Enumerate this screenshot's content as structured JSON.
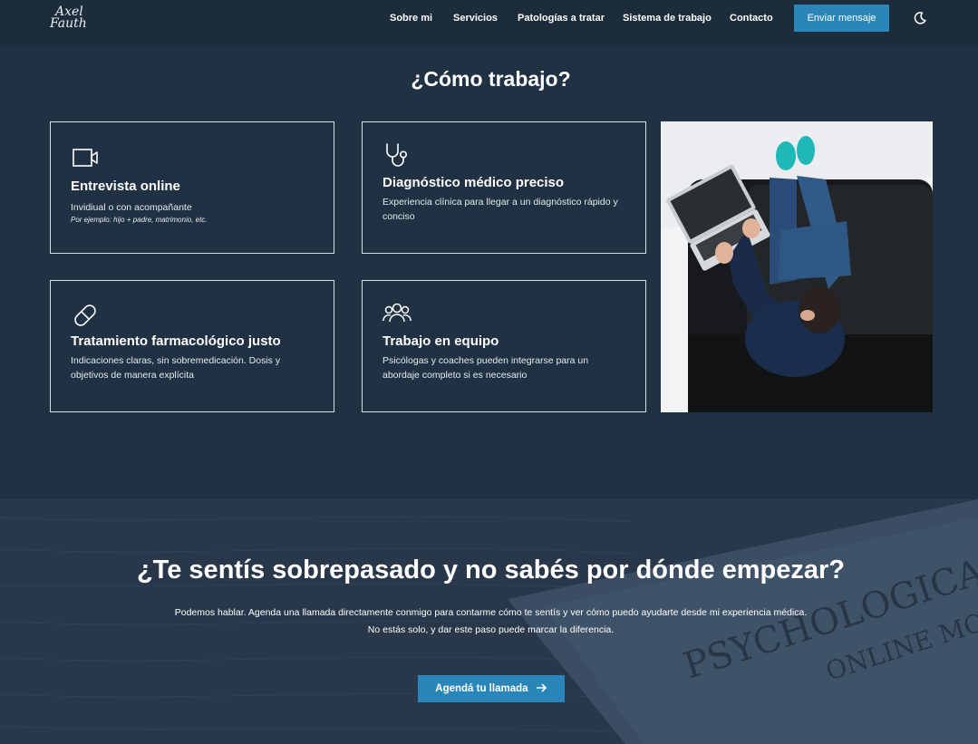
{
  "nav": {
    "logo": {
      "line1": "Axel",
      "line2": "Fauth"
    },
    "links": [
      "Sobre mi",
      "Servicios",
      "Patologías a tratar",
      "Sistema de trabajo",
      "Contacto"
    ],
    "cta": "Enviar mensaje",
    "theme_icon": "moon-icon"
  },
  "work": {
    "title": "¿Cómo trabajo?",
    "cards": [
      {
        "icon": "video-camera-icon",
        "title": "Entrevista online",
        "text": "Invidiual o con acompañante",
        "note": "Por ejemplo: hijo + padre, matrimonio, etc."
      },
      {
        "icon": "stethoscope-icon",
        "title": "Diagnóstico médico preciso",
        "text": "Experiencia clínica para llegar a un diagnóstico rápido y conciso"
      },
      {
        "icon": "pill-icon",
        "title": "Tratamiento farmacológico justo",
        "text": "Indicaciones claras, sin sobremedicación. Dosis y objetivos de manera explícita"
      },
      {
        "icon": "team-icon",
        "title": "Trabajo en equipo",
        "text": "Psicólogas y coaches pueden integrarse para un abordaje completo si es necesario"
      }
    ],
    "photo": "person-on-sofa-with-laptop"
  },
  "cta": {
    "title": "¿Te sentís sobrepasado y no sabés por dónde empezar?",
    "text1": "Podemos hablar. Agenda una llamada directamente conmigo para contarme cómo te sentís y ver cómo puedo ayudarte desde mi experiencia médica.",
    "text2": "No estás solo, y dar este paso puede marcar la diferencia.",
    "button": "Agendá tu llamada",
    "background_words": [
      "PSYCHOLOGICAL",
      "ONLINE MO"
    ]
  },
  "colors": {
    "background": "#1f3142",
    "nav": "#1c2c3b",
    "accent": "#2a86b8"
  }
}
